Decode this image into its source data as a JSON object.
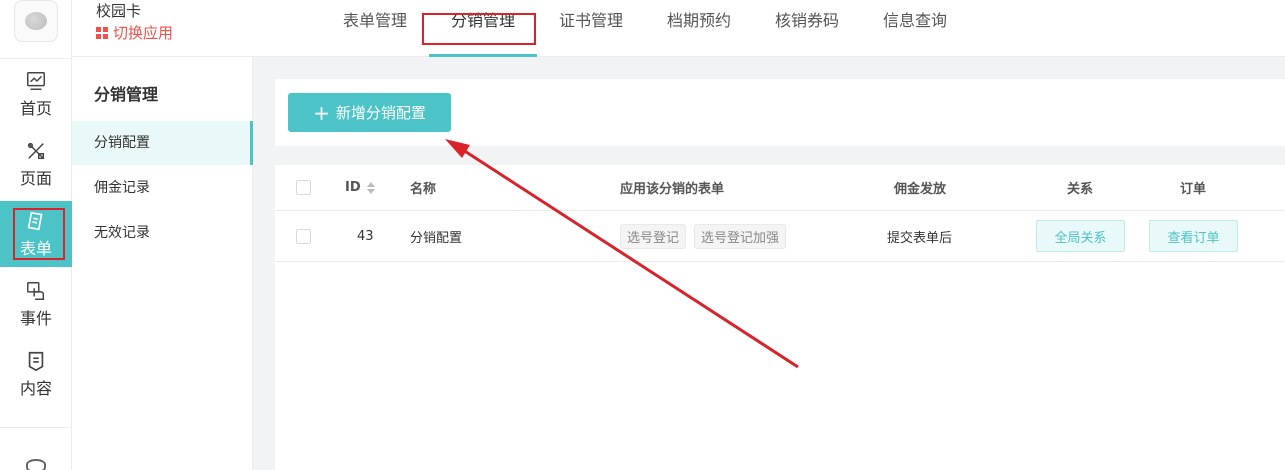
{
  "app": {
    "title": "校园卡",
    "switch_label": "切换应用"
  },
  "rail": {
    "items": [
      {
        "label": "首页",
        "icon": "chart-icon"
      },
      {
        "label": "页面",
        "icon": "tools-icon"
      },
      {
        "label": "表单",
        "icon": "form-icon"
      },
      {
        "label": "事件",
        "icon": "touch-icon"
      },
      {
        "label": "内容",
        "icon": "document-icon"
      }
    ],
    "active_index": 2
  },
  "top_tabs": {
    "items": [
      "表单管理",
      "分销管理",
      "证书管理",
      "档期预约",
      "核销券码",
      "信息查询"
    ],
    "active_index": 1
  },
  "subnav": {
    "title": "分销管理",
    "items": [
      "分销配置",
      "佣金记录",
      "无效记录"
    ],
    "active_index": 0
  },
  "toolbar": {
    "add_label": "新增分销配置"
  },
  "table": {
    "columns": [
      "ID",
      "名称",
      "应用该分销的表单",
      "佣金发放",
      "关系",
      "订单"
    ],
    "rows": [
      {
        "id": "43",
        "name": "分销配置",
        "forms": [
          "选号登记",
          "选号登记加强"
        ],
        "payout": "提交表单后",
        "relation_btn": "全局关系",
        "order_btn": "查看订单"
      }
    ]
  },
  "colors": {
    "accent": "#4cc3c7",
    "annotation": "#d9222a",
    "switch_app": "#f0504a"
  }
}
